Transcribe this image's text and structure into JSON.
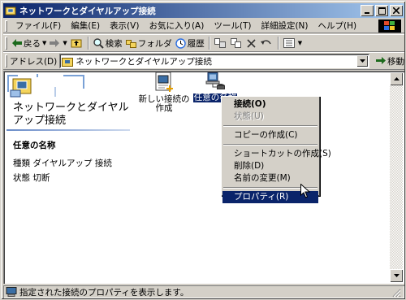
{
  "window": {
    "title": "ネットワークとダイヤルアップ接続"
  },
  "menubar": {
    "items": [
      {
        "label": "ファイル(F)"
      },
      {
        "label": "編集(E)"
      },
      {
        "label": "表示(V)"
      },
      {
        "label": "お気に入り(A)"
      },
      {
        "label": "ツール(T)"
      },
      {
        "label": "詳細設定(N)"
      },
      {
        "label": "ヘルプ(H)"
      }
    ]
  },
  "toolbar": {
    "back": "戻る",
    "search": "検索",
    "folders": "フォルダ",
    "history": "履歴"
  },
  "address": {
    "label": "アドレス(D)",
    "value": "ネットワークとダイヤルアップ接続",
    "go": "移動"
  },
  "panel": {
    "title": "ネットワークとダイヤルアップ接続",
    "selected_name": "任意の名称",
    "type_label": "種類",
    "type_value": "ダイヤルアップ 接続",
    "status_label": "状態",
    "status_value": "切断"
  },
  "icons": [
    {
      "label": "新しい接続の作成",
      "icon": "new-connection-icon"
    },
    {
      "label": "任意の名称",
      "icon": "dialup-connection-icon"
    }
  ],
  "context_menu": {
    "items": [
      {
        "label": "接続(O)",
        "state": "default"
      },
      {
        "label": "状態(U)",
        "state": "disabled"
      },
      {
        "label": "コピーの作成(C)",
        "state": "normal"
      },
      {
        "label": "ショートカットの作成(S)",
        "state": "normal"
      },
      {
        "label": "削除(D)",
        "state": "normal"
      },
      {
        "label": "名前の変更(M)",
        "state": "normal"
      },
      {
        "label": "プロパティ(R)",
        "state": "highlighted"
      }
    ]
  },
  "statusbar": {
    "text": "指定された接続のプロパティを表示します。"
  },
  "colors": {
    "title_start": "#0a246a",
    "title_end": "#a6caf0",
    "highlight": "#0a246a",
    "face": "#d4d0c8"
  }
}
